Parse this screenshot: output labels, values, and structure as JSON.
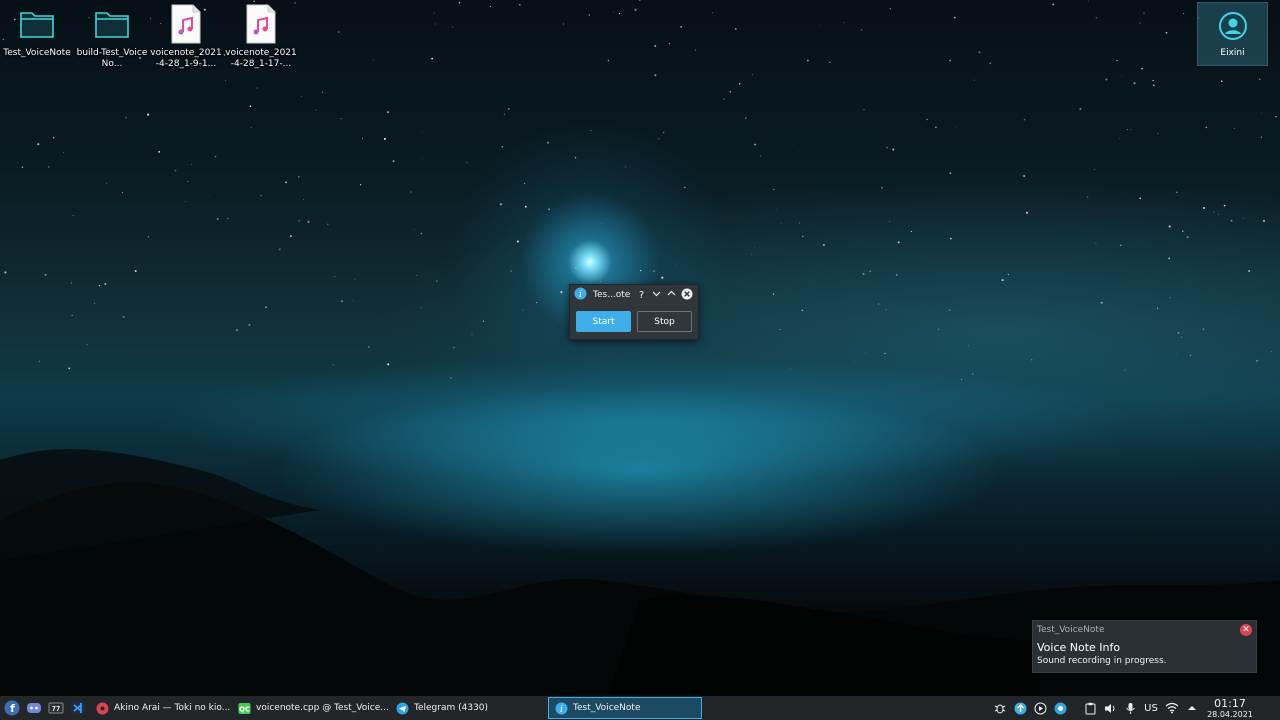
{
  "desktop": {
    "icons": [
      {
        "label": "Test_VoiceNote",
        "icon": "folder-icon"
      },
      {
        "label": "build-Test_VoiceNo...",
        "icon": "folder-icon"
      },
      {
        "label": "voicenote_2021-4-28_1-9-1...",
        "icon": "audio-file-icon"
      },
      {
        "label": "voicenote_2021-4-28_1-17-...",
        "icon": "audio-file-icon"
      }
    ],
    "user": {
      "name": "Eixini",
      "icon": "user-icon"
    }
  },
  "dialog": {
    "title": "Tes...ote",
    "help": "?",
    "start_label": "Start",
    "stop_label": "Stop"
  },
  "notification": {
    "app": "Test_VoiceNote",
    "title": "Voice Note Info",
    "body": "Sound recording in progress."
  },
  "taskbar": {
    "tasks": [
      {
        "label": "Akino Arai — Toki no kio..."
      },
      {
        "label": "voicenote.cpp @ Test_Voice..."
      },
      {
        "label": "Telegram (4330)"
      },
      {
        "label": "Test_VoiceNote"
      }
    ],
    "keyboard_layout": "US",
    "time": "01:17",
    "date": "28.04.2021"
  },
  "colors": {
    "accent": "#3daee9",
    "panel": "#232629",
    "dialog": "#31363b",
    "close": "#da4453"
  }
}
